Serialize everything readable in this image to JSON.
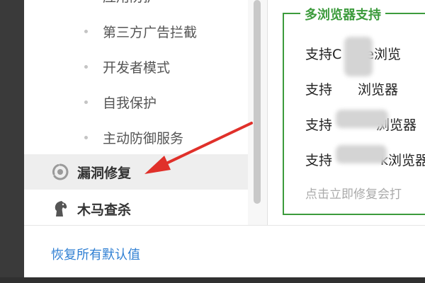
{
  "sidebar": {
    "sub_items": [
      {
        "label": "应用防护"
      },
      {
        "label": "第三方广告拦截"
      },
      {
        "label": "开发者模式"
      },
      {
        "label": "自我保护"
      },
      {
        "label": "主动防御服务"
      }
    ],
    "main_items": [
      {
        "label": "漏洞修复",
        "icon": "shield-refresh-icon",
        "selected": true
      },
      {
        "label": "木马查杀",
        "icon": "horse-icon",
        "selected": false
      }
    ]
  },
  "footer": {
    "restore_label": "恢复所有默认值"
  },
  "browser_group": {
    "title": "多浏览器支持",
    "options": [
      {
        "label": "支持C",
        "label_tail": "e浏览"
      },
      {
        "label": "支持",
        "label_tail": "浏览器"
      },
      {
        "label": "支持",
        "label_tail": "浏览器"
      },
      {
        "label": "支持",
        "label_tail": "k浏览器"
      }
    ],
    "note": "点击立即修复会打"
  },
  "colors": {
    "accent_green": "#3c9b3c",
    "link_blue": "#2f7fd3",
    "annotation_red": "#e0302a",
    "selected_bg": "#eeeeee"
  }
}
